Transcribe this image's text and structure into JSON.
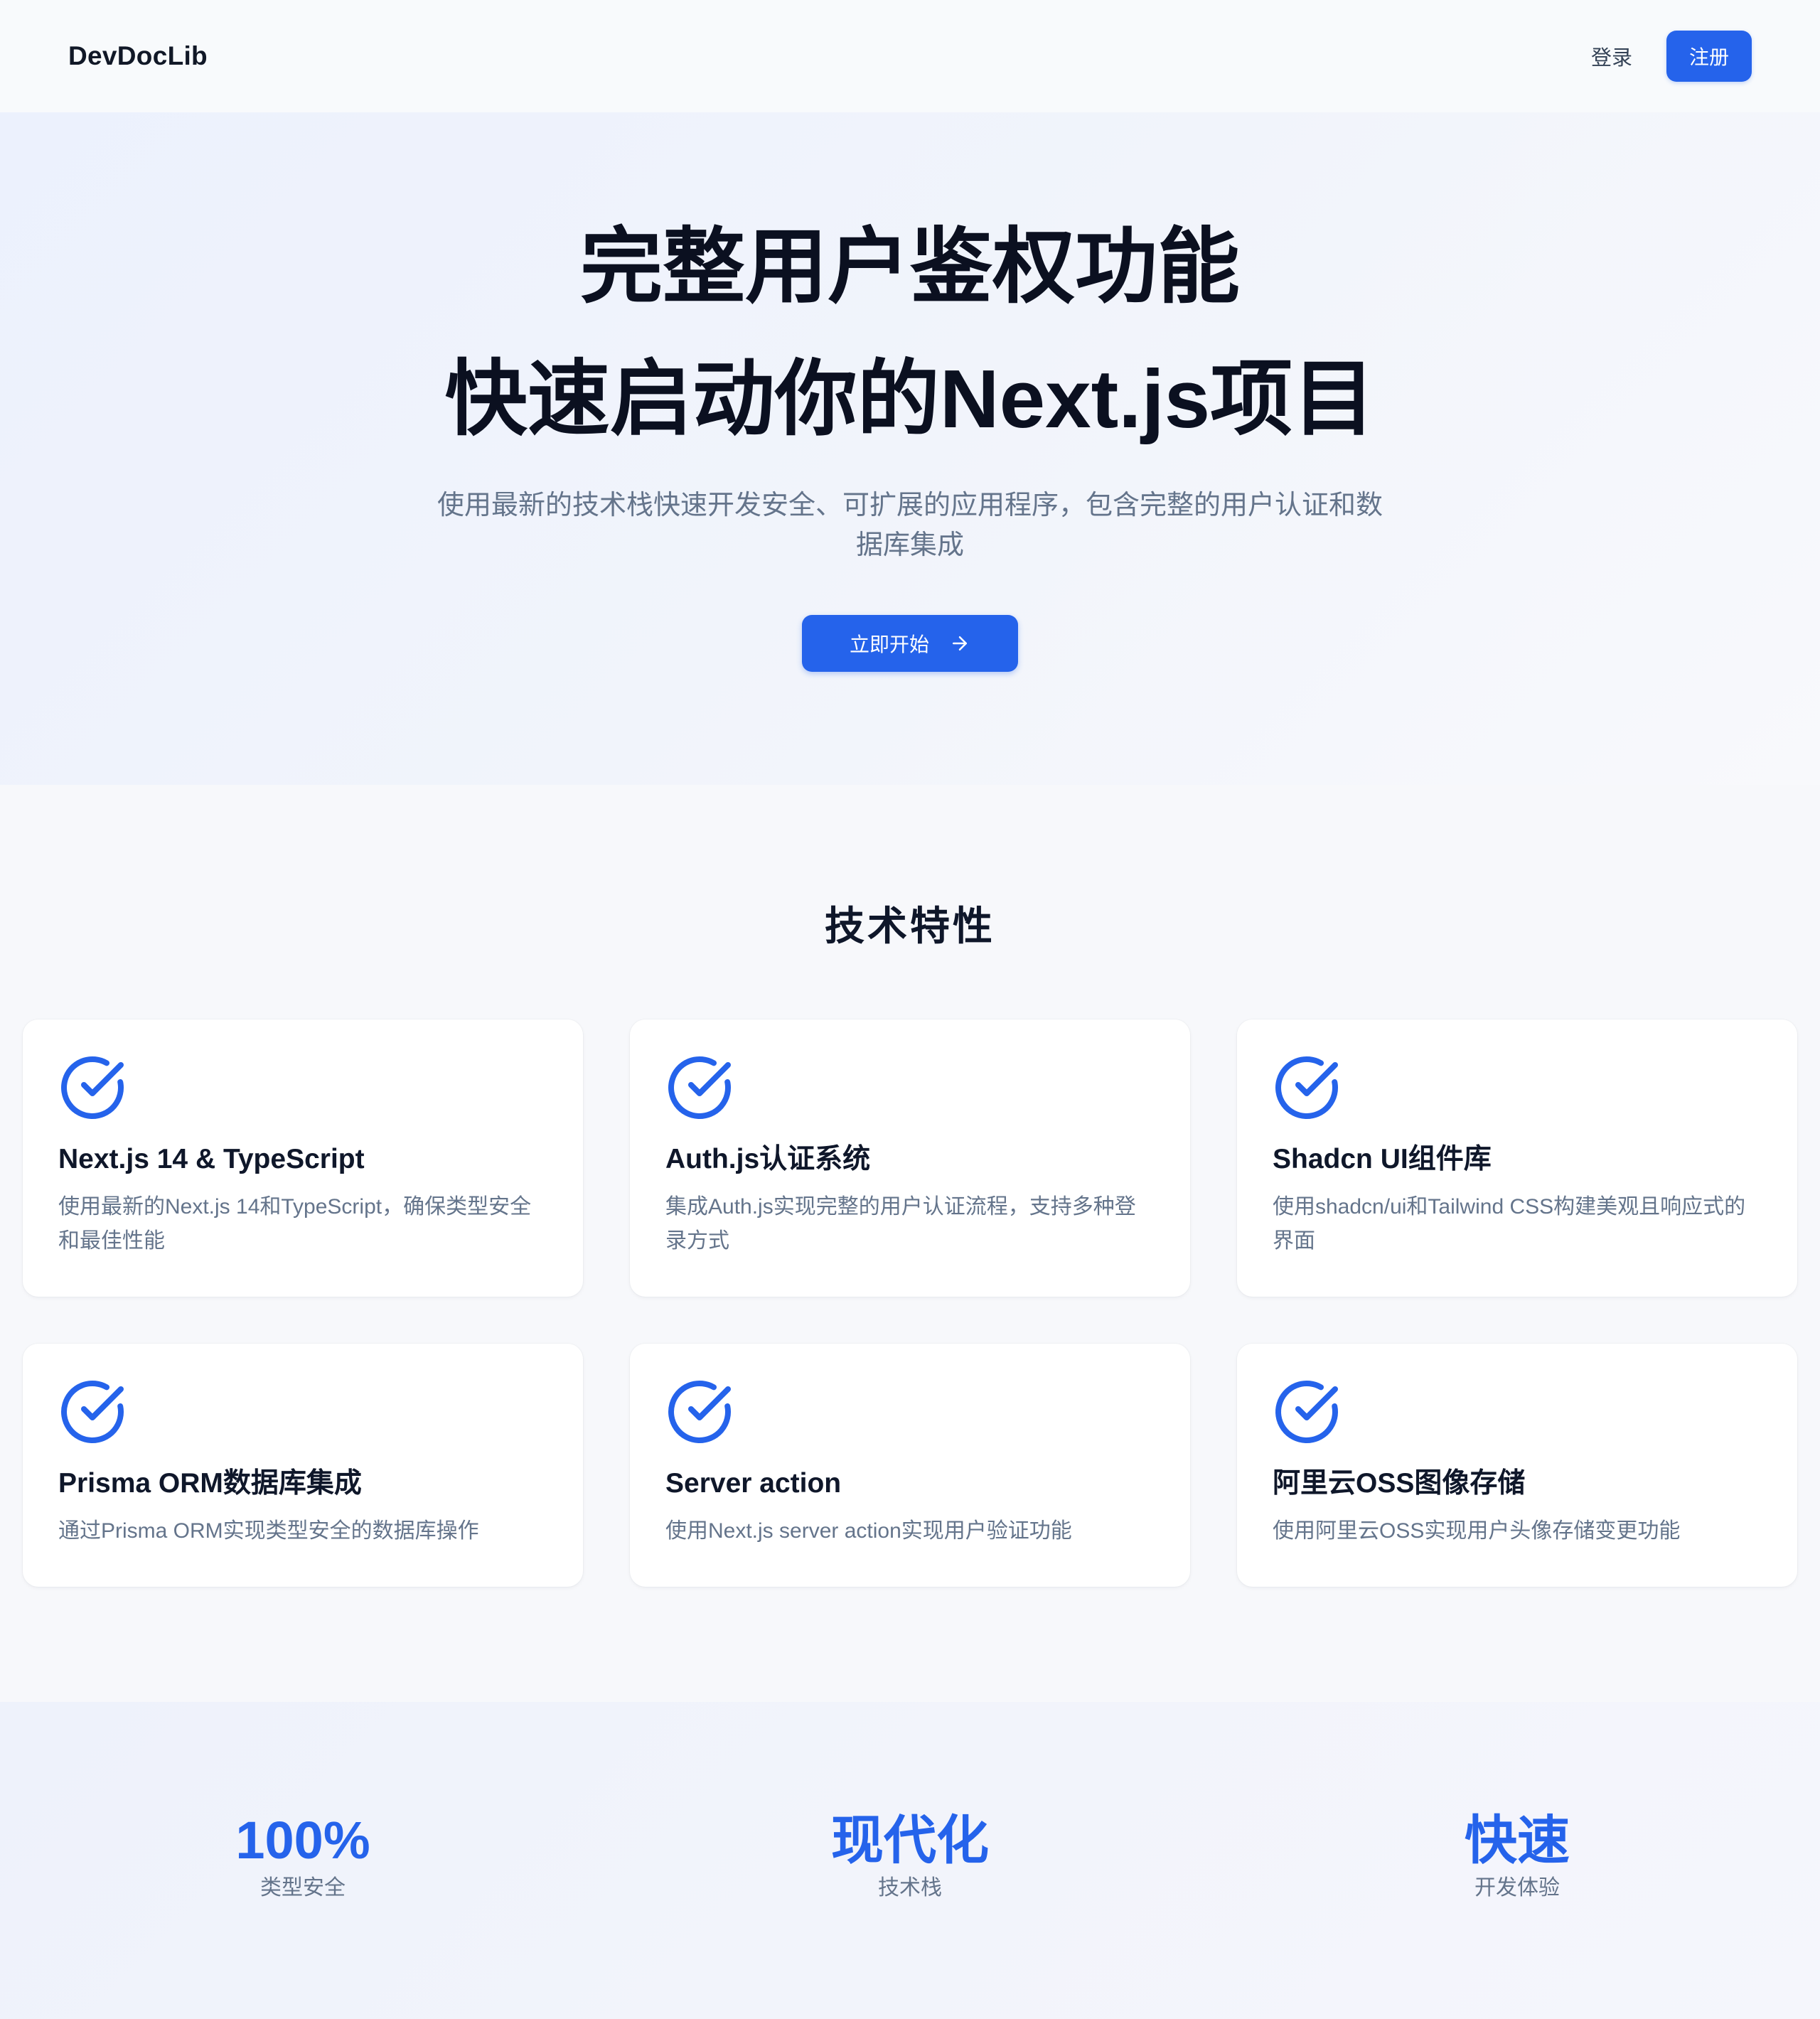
{
  "navbar": {
    "brand": "DevDocLib",
    "login_label": "登录",
    "register_label": "注册"
  },
  "hero": {
    "title_line1": "完整用户鉴权功能",
    "title_line2": "快速启动你的Next.js项目",
    "subtitle": "使用最新的技术栈快速开发安全、可扩展的应用程序，包含完整的用户认证和数据库集成",
    "cta_label": "立即开始"
  },
  "features": {
    "section_title": "技术特性",
    "items": [
      {
        "icon": "check-circle-icon",
        "title": "Next.js 14 & TypeScript",
        "desc": "使用最新的Next.js 14和TypeScript，确保类型安全和最佳性能"
      },
      {
        "icon": "check-circle-icon",
        "title": "Auth.js认证系统",
        "desc": "集成Auth.js实现完整的用户认证流程，支持多种登录方式"
      },
      {
        "icon": "check-circle-icon",
        "title": "Shadcn UI组件库",
        "desc": "使用shadcn/ui和Tailwind CSS构建美观且响应式的界面"
      },
      {
        "icon": "check-circle-icon",
        "title": "Prisma ORM数据库集成",
        "desc": "通过Prisma ORM实现类型安全的数据库操作"
      },
      {
        "icon": "check-circle-icon",
        "title": "Server action",
        "desc": "使用Next.js server action实现用户验证功能"
      },
      {
        "icon": "check-circle-icon",
        "title": "阿里云OSS图像存储",
        "desc": "使用阿里云OSS实现用户头像存储变更功能"
      }
    ]
  },
  "stats": [
    {
      "value": "100%",
      "label": "类型安全"
    },
    {
      "value": "现代化",
      "label": "技术栈"
    },
    {
      "value": "快速",
      "label": "开发体验"
    }
  ],
  "colors": {
    "accent": "#2563eb",
    "muted_text": "#64748b",
    "heading": "#0f172a"
  }
}
